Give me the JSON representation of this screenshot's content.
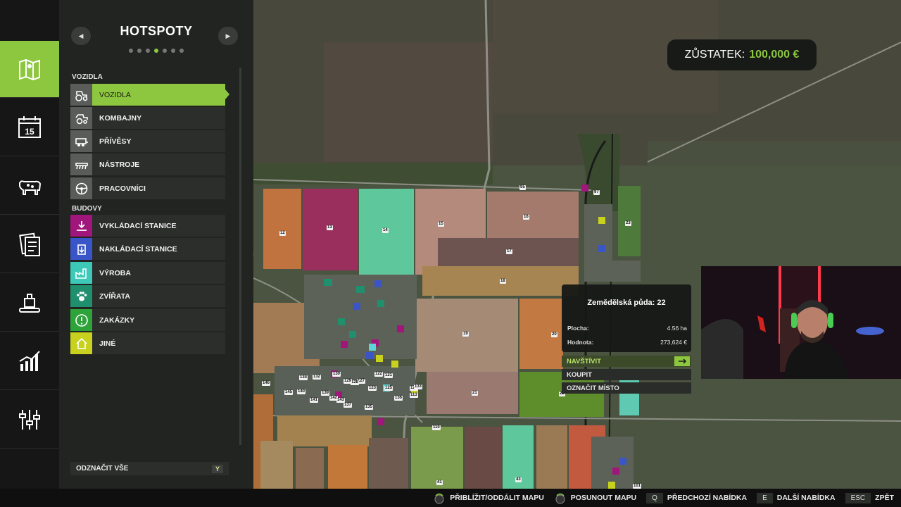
{
  "rail": {
    "items": [
      {
        "name": "map-icon",
        "active": true
      },
      {
        "name": "calendar-icon",
        "text": "15"
      },
      {
        "name": "animals-icon"
      },
      {
        "name": "contracts-icon"
      },
      {
        "name": "production-icon"
      },
      {
        "name": "statistics-icon"
      },
      {
        "name": "settings-icon"
      }
    ]
  },
  "panel": {
    "title": "HOTSPOTY",
    "page_count": 7,
    "active_page": 4,
    "sections": [
      {
        "label": "VOZIDLA",
        "items": [
          {
            "label": "VOZIDLA",
            "icon": "tractor-icon",
            "color": "#5a5c5a",
            "active": true
          },
          {
            "label": "KOMBAJNY",
            "icon": "harvester-icon",
            "color": "#5a5c5a"
          },
          {
            "label": "PŘÍVĚSY",
            "icon": "trailer-icon",
            "color": "#5a5c5a"
          },
          {
            "label": "NÁSTROJE",
            "icon": "tool-icon",
            "color": "#5a5c5a"
          },
          {
            "label": "PRACOVNÍCI",
            "icon": "steering-wheel-icon",
            "color": "#5a5c5a"
          }
        ]
      },
      {
        "label": "BUDOVY",
        "items": [
          {
            "label": "VYKLÁDACÍ STANICE",
            "icon": "unload-icon",
            "color": "#a0167a"
          },
          {
            "label": "NAKLÁDACÍ STANICE",
            "icon": "load-icon",
            "color": "#3a55c8"
          },
          {
            "label": "VÝROBA",
            "icon": "factory-icon",
            "color": "#3cc9b8"
          },
          {
            "label": "ZVÍŘATA",
            "icon": "paw-icon",
            "color": "#1f8f6e"
          },
          {
            "label": "ZAKÁZKY",
            "icon": "exclamation-icon",
            "color": "#2da33a"
          },
          {
            "label": "JINÉ",
            "icon": "house-icon",
            "color": "#c8d21e"
          }
        ]
      }
    ],
    "select_all_label": "ODZNAČIT VŠE",
    "select_all_key": "Y"
  },
  "balance": {
    "label": "ZŮSTATEK:",
    "value": "100,000 €"
  },
  "field_info": {
    "title": "Zemědělská půda: 22",
    "rows": [
      {
        "key": "Plocha:",
        "value": "4.56 ha"
      },
      {
        "key": "Hodnota:",
        "value": "273,624 €"
      }
    ],
    "actions": [
      "NAVŠTÍVIT",
      "KOUPIT",
      "OZNAČIT MÍSTO"
    ]
  },
  "map_labels": [
    "12",
    "13",
    "14",
    "15",
    "16",
    "17",
    "18",
    "19",
    "20",
    "21",
    "22",
    "23",
    "41",
    "43",
    "95",
    "97",
    "101",
    "110",
    "113",
    "121",
    "122",
    "123",
    "124",
    "125",
    "127",
    "128",
    "129",
    "130",
    "132",
    "133",
    "134",
    "135",
    "136",
    "137",
    "139",
    "140",
    "141",
    "142",
    "143",
    "145",
    "146"
  ],
  "bottom_bar": [
    {
      "icon": "zoom-stick-icon",
      "label": "PŘIBLÍŽIT/ODDÁLIT MAPU"
    },
    {
      "icon": "move-stick-icon",
      "label": "POSUNOUT MAPU"
    },
    {
      "key": "Q",
      "label": "PŘEDCHOZÍ NABÍDKA"
    },
    {
      "key": "E",
      "label": "DALŠÍ NABÍDKA"
    },
    {
      "key": "ESC",
      "label": "ZPĚT"
    }
  ]
}
